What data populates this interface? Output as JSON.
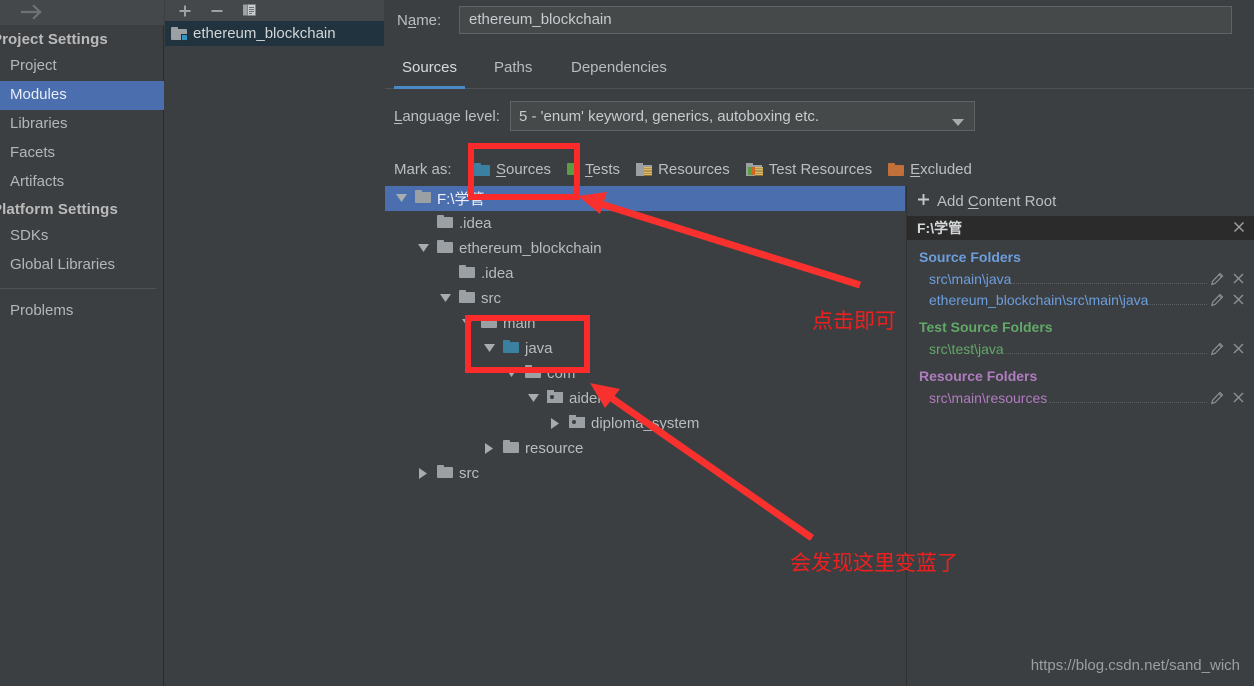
{
  "sidebar": {
    "forward_icon": "arrow-right-icon",
    "groups": [
      {
        "title": "Project Settings",
        "items": [
          {
            "label": "Project",
            "selected": false
          },
          {
            "label": "Modules",
            "selected": true
          },
          {
            "label": "Libraries",
            "selected": false
          },
          {
            "label": "Facets",
            "selected": false
          },
          {
            "label": "Artifacts",
            "selected": false
          }
        ]
      },
      {
        "title": "Platform Settings",
        "items": [
          {
            "label": "SDKs",
            "selected": false
          },
          {
            "label": "Global Libraries",
            "selected": false
          }
        ]
      }
    ],
    "problems_label": "Problems"
  },
  "module_panel": {
    "toolbar": {
      "add_icon": "plus-icon",
      "remove_icon": "minus-icon",
      "copy_icon": "copy-module-icon"
    },
    "modules": [
      {
        "label": "ethereum_blockchain",
        "selected": true
      }
    ]
  },
  "main": {
    "name": {
      "label": "Name:",
      "value": "ethereum_blockchain"
    },
    "tabs": [
      {
        "label": "Sources",
        "active": true
      },
      {
        "label": "Paths",
        "active": false
      },
      {
        "label": "Dependencies",
        "active": false
      }
    ],
    "language_level": {
      "label": "Language level:",
      "value": "5 - 'enum' keyword, generics, autoboxing etc.",
      "caret_icon": "chevron-down-icon"
    },
    "mark_as": {
      "label": "Mark as:",
      "options": [
        {
          "label": "Sources",
          "icon": "folder-sources-icon",
          "color": "#3b80a0"
        },
        {
          "label": "Tests",
          "icon": "folder-tests-icon",
          "color": "#5a9e43"
        },
        {
          "label": "Resources",
          "icon": "folder-resources-icon",
          "color": "#9aa0a4"
        },
        {
          "label": "Test Resources",
          "icon": "folder-test-resources-icon",
          "color": "#9aa0a4"
        },
        {
          "label": "Excluded",
          "icon": "folder-excluded-icon",
          "color": "#c2703a"
        }
      ]
    }
  },
  "tree": {
    "nodes": [
      {
        "label": "F:\\学管",
        "indent": 0,
        "twisty": "down",
        "icon": "folder-icon",
        "color": "#9aa0a4",
        "selected": true
      },
      {
        "label": ".idea",
        "indent": 1,
        "twisty": "none",
        "icon": "folder-icon",
        "color": "#9aa0a4",
        "selected": false
      },
      {
        "label": "ethereum_blockchain",
        "indent": 1,
        "twisty": "down",
        "icon": "folder-icon",
        "color": "#9aa0a4",
        "selected": false
      },
      {
        "label": ".idea",
        "indent": 2,
        "twisty": "none",
        "icon": "folder-icon",
        "color": "#9aa0a4",
        "selected": false
      },
      {
        "label": "src",
        "indent": 2,
        "twisty": "down",
        "icon": "folder-icon",
        "color": "#9aa0a4",
        "selected": false
      },
      {
        "label": "main",
        "indent": 3,
        "twisty": "down",
        "icon": "folder-icon",
        "color": "#9aa0a4",
        "selected": false
      },
      {
        "label": "java",
        "indent": 4,
        "twisty": "down",
        "icon": "folder-sources-icon",
        "color": "#3b80a0",
        "selected": false
      },
      {
        "label": "com",
        "indent": 5,
        "twisty": "down",
        "icon": "folder-icon",
        "color": "#9aa0a4",
        "selected": false
      },
      {
        "label": "aiden",
        "indent": 6,
        "twisty": "down",
        "icon": "package-icon",
        "color": "#9aa0a4",
        "selected": false
      },
      {
        "label": "diploma_system",
        "indent": 7,
        "twisty": "right",
        "icon": "package-icon",
        "color": "#9aa0a4",
        "selected": false
      },
      {
        "label": "resource",
        "indent": 4,
        "twisty": "right",
        "icon": "folder-icon",
        "color": "#9aa0a4",
        "selected": false
      },
      {
        "label": "src",
        "indent": 1,
        "twisty": "right",
        "icon": "folder-icon",
        "color": "#9aa0a4",
        "selected": false
      }
    ]
  },
  "right_panel": {
    "add_content_root": {
      "label": "Add Content Root",
      "icon": "plus-icon"
    },
    "content_root": {
      "label": "F:\\学管",
      "remove_icon": "close-icon"
    },
    "sections": [
      {
        "title": "Source Folders",
        "kind": "src",
        "folders": [
          {
            "path": "src\\main\\java"
          },
          {
            "path": "ethereum_blockchain\\src\\main\\java"
          }
        ]
      },
      {
        "title": "Test Source Folders",
        "kind": "test",
        "folders": [
          {
            "path": "src\\test\\java"
          }
        ]
      },
      {
        "title": "Resource Folders",
        "kind": "res",
        "folders": [
          {
            "path": "src\\main\\resources"
          }
        ]
      }
    ],
    "edit_icon": "pencil-icon",
    "remove_icon": "close-icon"
  },
  "annotations": {
    "color": "#f01f1f",
    "callout_click": "点击即可",
    "callout_blue": "会发现这里变蓝了"
  },
  "watermark": "https://blog.csdn.net/sand_wich"
}
